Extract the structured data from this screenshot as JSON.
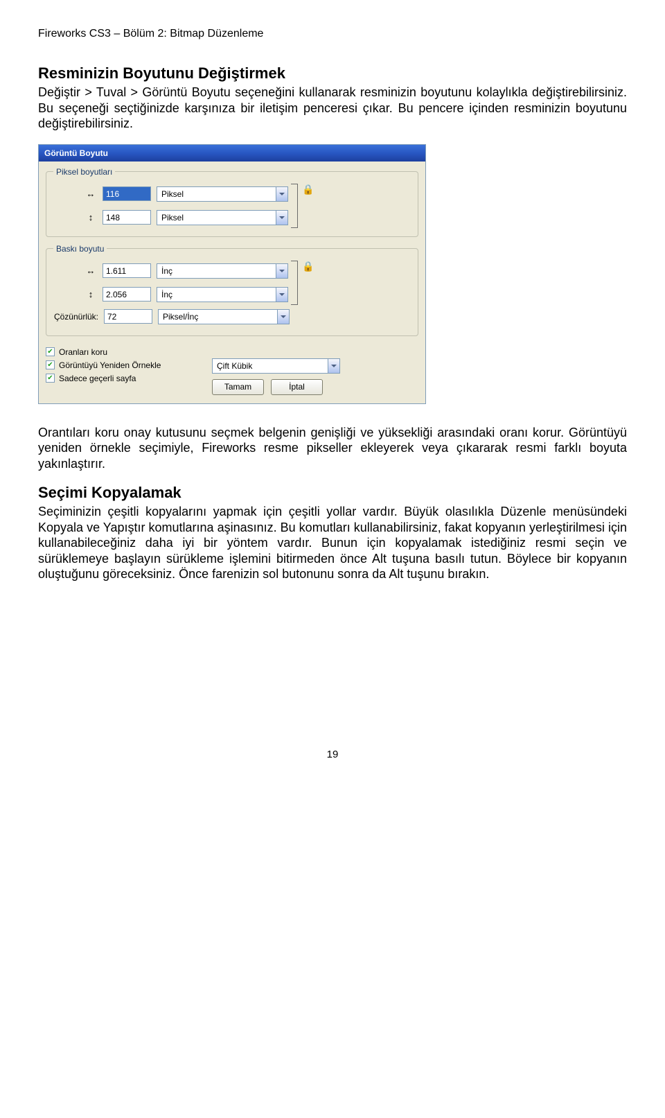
{
  "header": "Fireworks CS3 – Bölüm 2: Bitmap Düzenleme",
  "section1": {
    "title": "Resminizin Boyutunu Değiştirmek",
    "para": "Değiştir > Tuval > Görüntü Boyutu seçeneğini kullanarak resminizin boyutunu kolaylıkla değiştirebilirsiniz. Bu seçeneği seçtiğinizde karşınıza bir iletişim penceresi çıkar. Bu pencere içinden resminizin boyutunu değiştirebilirsiniz."
  },
  "dialog": {
    "title": "Görüntü Boyutu",
    "pixel_group": {
      "legend": "Piksel boyutları",
      "width": "116",
      "height": "148",
      "unit": "Piksel"
    },
    "print_group": {
      "legend": "Baskı boyutu",
      "width": "1.611",
      "height": "2.056",
      "unit": "İnç",
      "res_label": "Çözünürlük:",
      "res_value": "72",
      "res_unit": "Piksel/İnç"
    },
    "checks": {
      "c1": "Oranları koru",
      "c2": "Görüntüyü Yeniden Örnekle",
      "c3": "Sadece geçerli sayfa"
    },
    "resample_combo": "Çift Kübik",
    "ok": "Tamam",
    "cancel": "İptal"
  },
  "section2": {
    "para1": "Orantıları koru onay kutusunu seçmek belgenin genişliği ve yüksekliği arasındaki oranı korur. Görüntüyü yeniden örnekle seçimiyle, Fireworks resme pikseller ekleyerek veya çıkararak resmi farklı boyuta yakınlaştırır."
  },
  "section3": {
    "title": "Seçimi Kopyalamak",
    "para": "Seçiminizin çeşitli kopyalarını yapmak için çeşitli yollar vardır. Büyük olasılıkla Düzenle menüsündeki Kopyala ve Yapıştır komutlarına aşinasınız. Bu komutları kullanabilirsiniz, fakat kopyanın yerleştirilmesi için kullanabileceğiniz daha iyi bir yöntem vardır. Bunun için kopyalamak istediğiniz resmi seçin ve sürüklemeye başlayın sürükleme işlemini bitirmeden önce Alt tuşuna basılı tutun. Böylece bir kopyanın oluştuğunu göreceksiniz. Önce farenizin sol butonunu sonra da Alt tuşunu bırakın."
  },
  "page_number": "19"
}
